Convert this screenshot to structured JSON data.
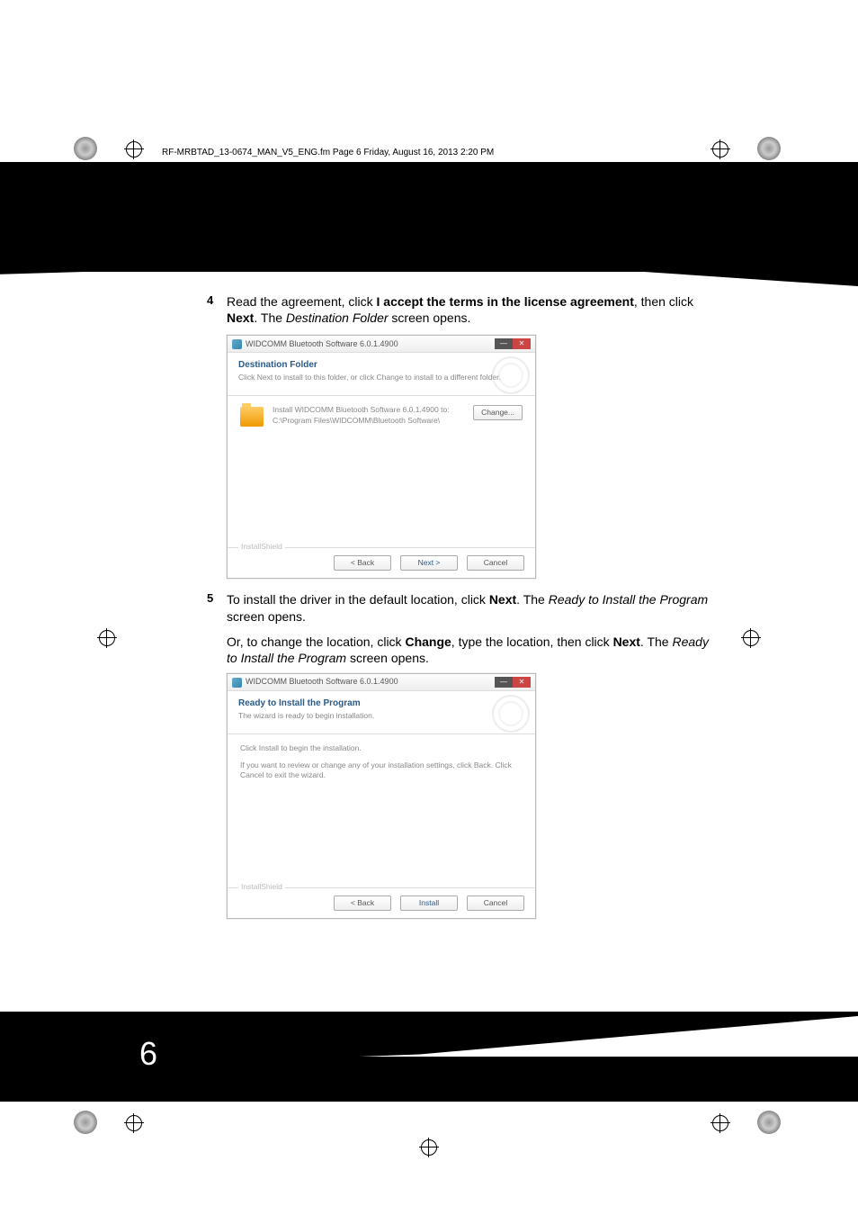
{
  "header_line": "RF-MRBTAD_13-0674_MAN_V5_ENG.fm  Page 6  Friday, August 16, 2013  2:20 PM",
  "page_number": "6",
  "step4": {
    "num": "4",
    "t1": "Read the agreement, click ",
    "b1": "I accept the terms in the license agreement",
    "t2": ", then click ",
    "b2": "Next",
    "t3": ". The ",
    "i1": "Destination Folder",
    "t4": " screen opens."
  },
  "dlg1": {
    "title": "WIDCOMM Bluetooth Software 6.0.1.4900",
    "head": "Destination Folder",
    "sub": "Click Next to install to this folder, or click Change to install to a different folder.",
    "line1": "Install WIDCOMM Bluetooth Software 6.0.1.4900   to:",
    "line2": "C:\\Program Files\\WIDCOMM\\Bluetooth Software\\",
    "change": "Change...",
    "ishield": "InstallShield",
    "back": "< Back",
    "next": "Next >",
    "cancel": "Cancel"
  },
  "step5": {
    "num": "5",
    "t1": "To install the driver in the default location, click ",
    "b1": "Next",
    "t2": ". The ",
    "i1": "Ready to Install the Program",
    "t3": " screen opens."
  },
  "or_para": {
    "t1": "Or, to change the location, click ",
    "b1": "Change",
    "t2": ", type the location, then click ",
    "b2": "Next",
    "t3": ". The ",
    "i1": "Ready to Install the Program",
    "t4": " screen opens."
  },
  "dlg2": {
    "title": "WIDCOMM Bluetooth Software 6.0.1.4900",
    "head": "Ready to Install the Program",
    "sub": "The wizard is ready to begin installation.",
    "line1": "Click Install to begin the installation.",
    "line2": "If you want to review or change any of your installation settings, click Back. Click Cancel to exit the wizard.",
    "ishield": "InstallShield",
    "back": "< Back",
    "install": "Install",
    "cancel": "Cancel"
  }
}
